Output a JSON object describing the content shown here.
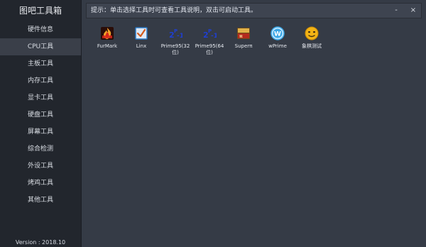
{
  "sidebar": {
    "title": "图吧工具箱",
    "items": [
      {
        "label": "硬件信息"
      },
      {
        "label": "CPU工具"
      },
      {
        "label": "主板工具"
      },
      {
        "label": "内存工具"
      },
      {
        "label": "显卡工具"
      },
      {
        "label": "硬盘工具"
      },
      {
        "label": "屏幕工具"
      },
      {
        "label": "综合检测"
      },
      {
        "label": "外设工具"
      },
      {
        "label": "烤鸡工具"
      },
      {
        "label": "其他工具"
      }
    ],
    "version": "Version : 2018.10"
  },
  "header": {
    "hint": "提示：单击选择工具时可查看工具说明，双击可启动工具。",
    "minimize": "-",
    "close": "×"
  },
  "tools": [
    {
      "label": "FurMark",
      "icon": "furmark-icon",
      "color": "#d7261b"
    },
    {
      "label": "Linx",
      "icon": "linx-check-icon",
      "color": "#2b78c4"
    },
    {
      "label": "Prime95(32位)",
      "icon": "prime95-icon",
      "color": "#1f3fd1"
    },
    {
      "label": "Prime95(64位)",
      "icon": "prime95-icon",
      "color": "#1f3fd1"
    },
    {
      "label": "Superπ",
      "icon": "superpi-icon",
      "color": "#b8842a"
    },
    {
      "label": "wPrime",
      "icon": "wprime-icon",
      "color": "#3ba7e6"
    },
    {
      "label": "象棋测试",
      "icon": "chess-face-icon",
      "color": "#f2b315"
    }
  ]
}
